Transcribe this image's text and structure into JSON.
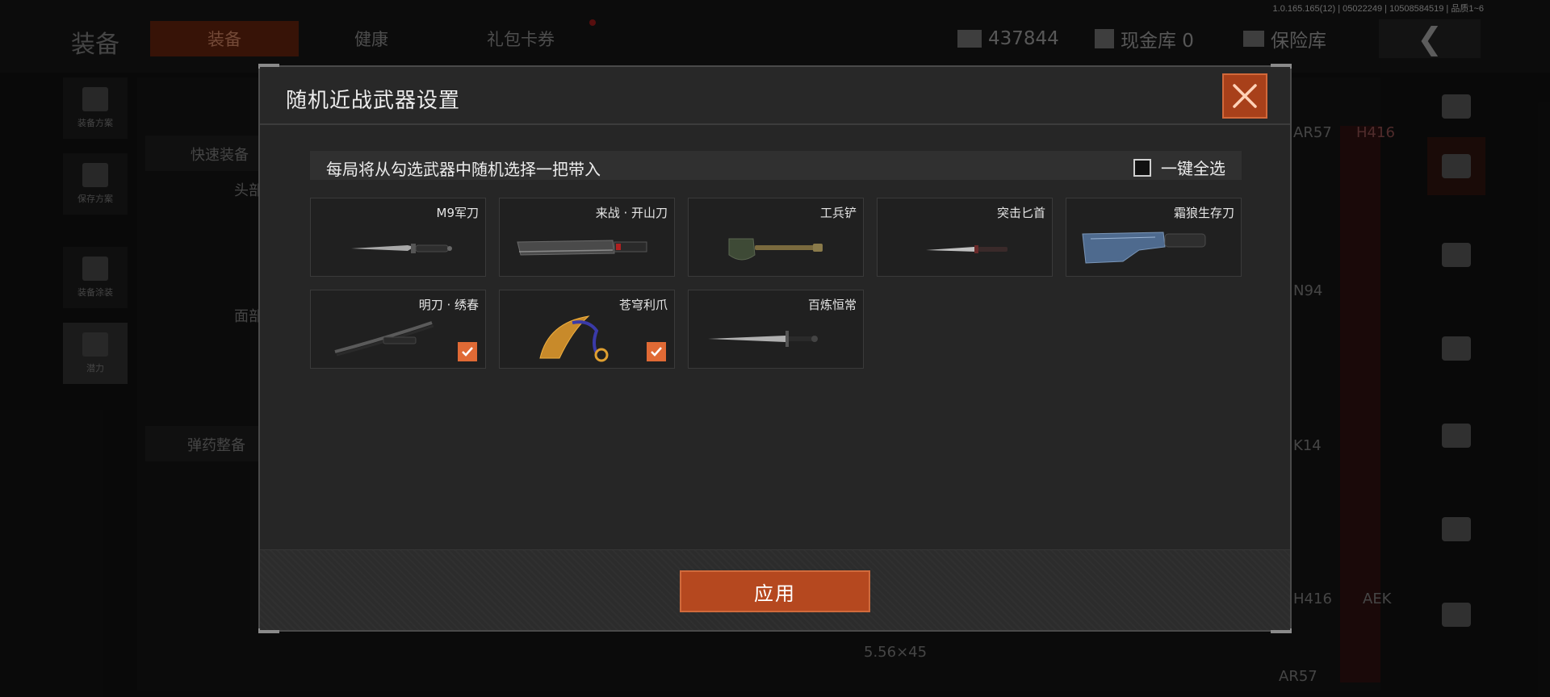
{
  "version": "1.0.165.165(12) | 05022249 | 10508584519 | 品质1~6",
  "background": {
    "title": "装备",
    "tabs": [
      "装备",
      "健康",
      "礼包卡券"
    ],
    "currency": "437844",
    "cash_vault": "现金库 0",
    "safe_box": "保险库",
    "left_nav": [
      "装备方案",
      "保存方案",
      "装备涂装",
      "潜力"
    ],
    "quick_equip": "快速装备",
    "ammo_prep": "弹药整备",
    "slot_head": "头部",
    "slot_face": "面部",
    "weapon_labels": [
      "AR57",
      "H416",
      "N94",
      "K14",
      "H416",
      "AEK",
      "AR57"
    ],
    "ammo_label": "5.56×45"
  },
  "modal": {
    "title": "随机近战武器设置",
    "instruction": "每局将从勾选武器中随机选择一把带入",
    "select_all_label": "一键全选",
    "select_all_checked": false,
    "apply_label": "应用",
    "accent_color": "#b5481f",
    "weapons": [
      {
        "name": "M9军刀",
        "icon": "bayonet-icon",
        "checked": false
      },
      {
        "name": "来战 · 开山刀",
        "icon": "machete-icon",
        "checked": false
      },
      {
        "name": "工兵铲",
        "icon": "shovel-icon",
        "checked": false
      },
      {
        "name": "突击匕首",
        "icon": "dagger-icon",
        "checked": false
      },
      {
        "name": "霜狼生存刀",
        "icon": "survival-knife-icon",
        "checked": false
      },
      {
        "name": "明刀 · 绣春",
        "icon": "saber-icon",
        "checked": true
      },
      {
        "name": "苍穹利爪",
        "icon": "karambit-icon",
        "checked": true
      },
      {
        "name": "百炼恒常",
        "icon": "sword-icon",
        "checked": false
      }
    ]
  }
}
